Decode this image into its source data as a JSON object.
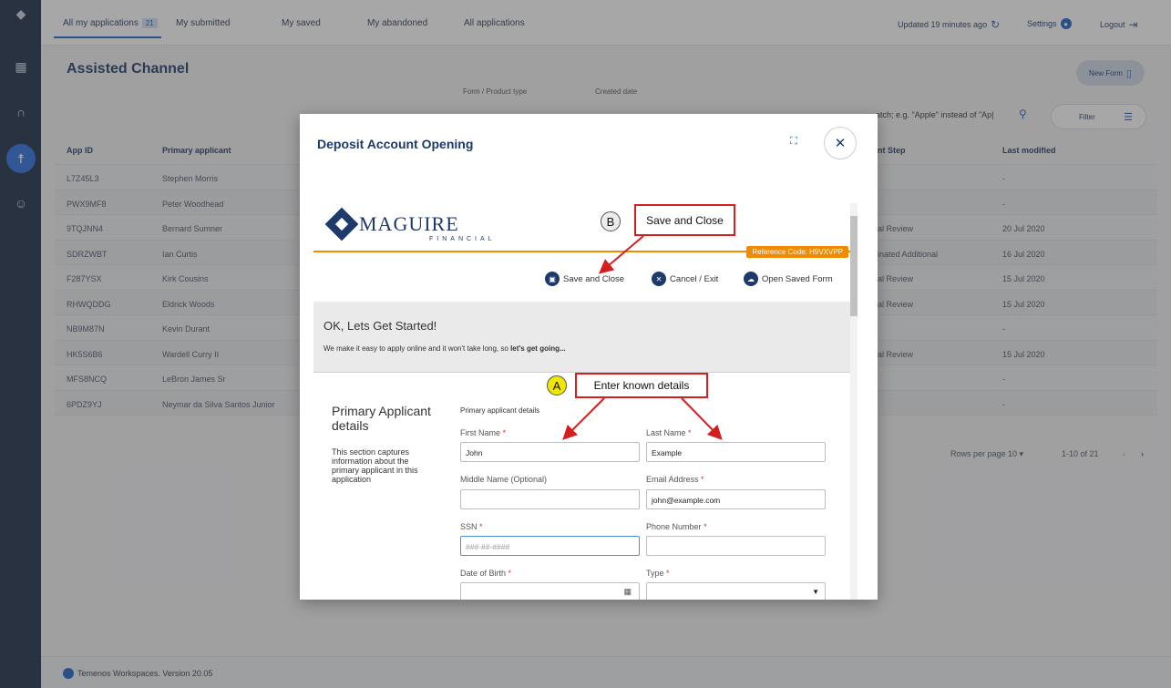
{
  "nav_tabs": [
    {
      "label": "All my applications",
      "badge": "21"
    },
    {
      "label": "My submitted"
    },
    {
      "label": "My saved"
    },
    {
      "label": "My abandoned"
    },
    {
      "label": "All applications"
    }
  ],
  "top_right": {
    "updated": "Updated 19 minutes ago",
    "settings": "Settings",
    "logout": "Logout"
  },
  "page_title": "Assisted Channel",
  "new_form": "New Form",
  "filters": {
    "form_type_label": "Form / Product type",
    "created_date_label": "Created date",
    "search_text": "atch; e.g. \"Apple\" instead of \"Ap|",
    "filter_label": "Filter"
  },
  "table": {
    "headers": {
      "app_id": "App ID",
      "primary": "Primary applicant",
      "step": "nt Step",
      "modified": "Last modified"
    },
    "rows": [
      {
        "id": "L7Z45L3",
        "name": "Stephen Morris",
        "step": "",
        "modified": "-"
      },
      {
        "id": "PWX9MF8",
        "name": "Peter Woodhead",
        "step": "",
        "modified": "-"
      },
      {
        "id": "9TQJNN4",
        "name": "Bernard Sumner",
        "step": "al Review",
        "modified": "20 Jul 2020"
      },
      {
        "id": "SDRZWBT",
        "name": "Ian Curtis",
        "step": "inated Additional",
        "modified": "16 Jul 2020"
      },
      {
        "id": "F287YSX",
        "name": "Kirk Cousins",
        "step": "al Review",
        "modified": "15 Jul 2020"
      },
      {
        "id": "RHWQDDG",
        "name": "Eldrick Woods",
        "step": "al Review",
        "modified": "15 Jul 2020"
      },
      {
        "id": "NB9M87N",
        "name": "Kevin Durant",
        "step": "",
        "modified": "-"
      },
      {
        "id": "HK5S6B6",
        "name": "Wardell Curry II",
        "step": "al Review",
        "modified": "15 Jul 2020"
      },
      {
        "id": "MFS8NCQ",
        "name": "LeBron James Sr",
        "step": "",
        "modified": "-"
      },
      {
        "id": "6PDZ9YJ",
        "name": "Neymar da Silva Santos Junior",
        "step": "",
        "modified": "-"
      }
    ],
    "rows_per_page": "Rows per page  10 ▾",
    "range": "1-10 of 21"
  },
  "footer": "Temenos Workspaces. Version 20.05",
  "modal": {
    "title": "Deposit Account Opening",
    "logo_text": "MAGUIRE",
    "logo_sub": "FINANCIAL",
    "ref_code": "Reference Code: H9VXVPP",
    "actions": {
      "save": "Save and Close",
      "cancel": "Cancel / Exit",
      "open": "Open Saved Form"
    },
    "started_title": "OK, Lets Get Started!",
    "started_text_pre": "We make it easy to apply online and it won't take long, so ",
    "started_text_bold": "let's get going...",
    "section_title": "Primary Applicant details",
    "section_desc": "This section captures information about the primary applicant in this application",
    "fields_header": "Primary applicant details",
    "fields": {
      "first_name": {
        "label": "First Name",
        "value": "John"
      },
      "last_name": {
        "label": "Last Name",
        "value": "Example"
      },
      "middle_name": {
        "label": "Middle Name (Optional)",
        "value": ""
      },
      "email": {
        "label": "Email Address",
        "value": "john@example.com"
      },
      "ssn": {
        "label": "SSN",
        "placeholder": "###-##-####"
      },
      "phone": {
        "label": "Phone Number",
        "value": ""
      },
      "dob": {
        "label": "Date of Birth",
        "value": ""
      },
      "type": {
        "label": "Type",
        "value": ""
      }
    }
  },
  "annotations": {
    "a_badge": "A",
    "a_text": "Enter known details",
    "b_badge": "B",
    "b_text": "Save and Close"
  },
  "colors": {
    "navy": "#1e3a6b",
    "accent": "#1e5fc8",
    "orange": "#f08a00",
    "annotation_red": "#d41f1f"
  }
}
